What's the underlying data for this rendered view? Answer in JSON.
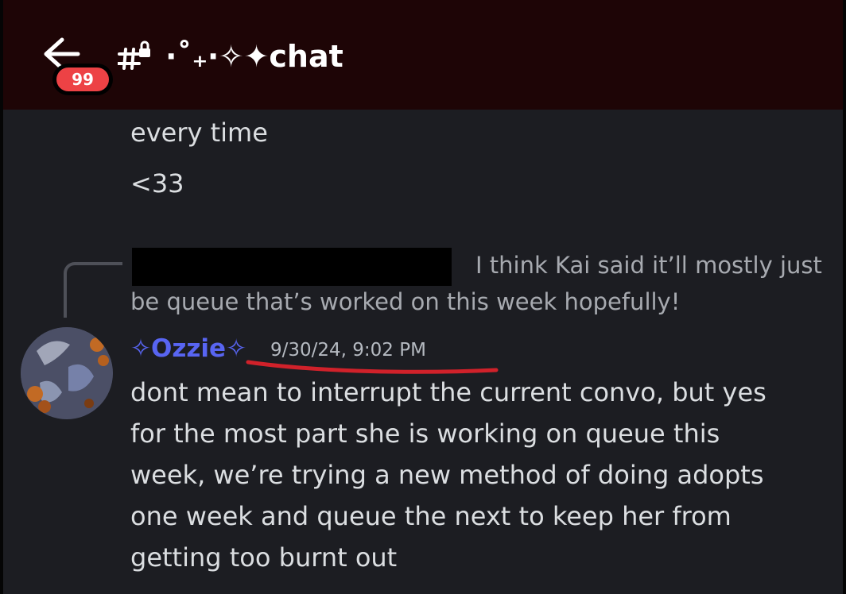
{
  "header": {
    "badge_count": "99",
    "channel_name": "·˚₊‧✧✦chat"
  },
  "messages": {
    "previous": [
      "every time",
      "<33"
    ],
    "reply_preview": {
      "line_1": "I think Kai said it’ll mostly just",
      "line_2": "be queue that’s worked on this week hopefully!"
    },
    "current": {
      "username": "✧Ozzie✧",
      "timestamp": "9/30/24, 9:02 PM",
      "lines": [
        "dont mean to interrupt the current convo, but yes",
        "for the most part she is working on queue this",
        "week, we’re trying a new method of doing adopts",
        "one week and queue the next to keep her from",
        "getting too burnt out"
      ]
    }
  },
  "colors": {
    "header_bg": "#1e0506",
    "chat_bg": "#1c1d22",
    "username_color": "#5865f2",
    "badge_color": "#ed4245",
    "annotation_red": "#d0212a"
  },
  "icons": [
    "back-arrow-icon",
    "text-channel-locked-icon",
    "avatar"
  ]
}
